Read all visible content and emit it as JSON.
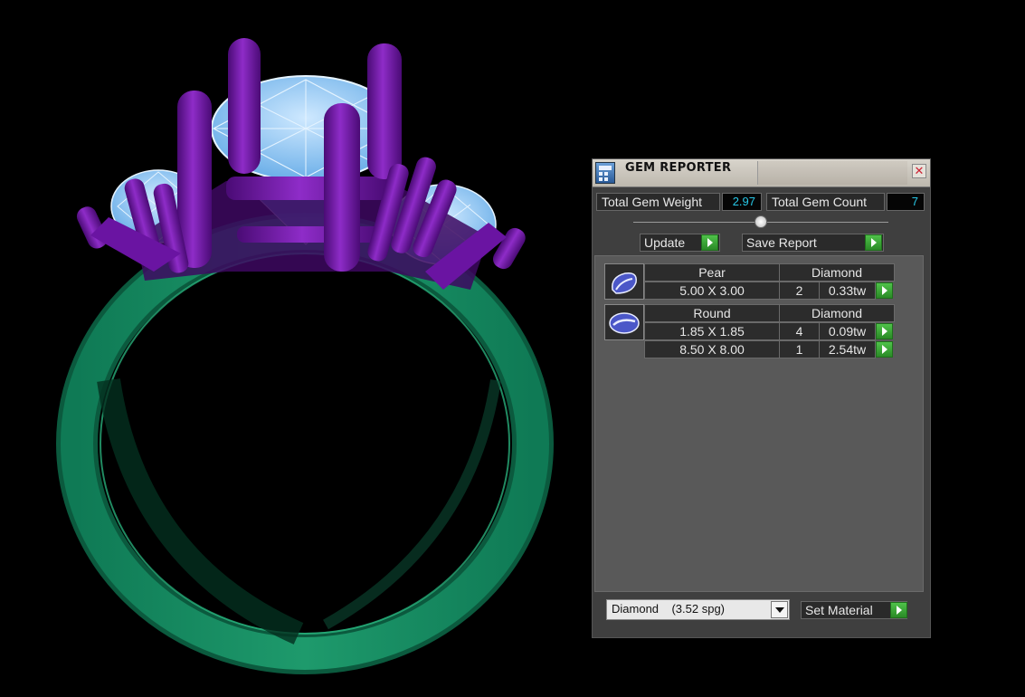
{
  "panel": {
    "title": "GEM REPORTER",
    "close_label": "✕",
    "total_gem_weight_label": "Total Gem Weight",
    "total_gem_weight_value": "2.97",
    "total_gem_count_label": "Total Gem Count",
    "total_gem_count_value": "7",
    "update_label": "Update",
    "save_report_label": "Save Report",
    "gems": [
      {
        "shape": "Pear",
        "material": "Diamond",
        "sizes": [
          {
            "dimensions": "5.00 X 3.00",
            "count": "2",
            "weight": "0.33tw"
          }
        ]
      },
      {
        "shape": "Round",
        "material": "Diamond",
        "sizes": [
          {
            "dimensions": "1.85 X 1.85",
            "count": "4",
            "weight": "0.09tw"
          },
          {
            "dimensions": "8.50 X 8.00",
            "count": "1",
            "weight": "2.54tw"
          }
        ]
      }
    ],
    "material_select": "Diamond    (3.52 spg)",
    "set_material_label": "Set Material"
  },
  "colors": {
    "metal": "#7a1ab0",
    "shank": "#0f7a55",
    "gem": "#9fd2ff",
    "value_text": "#27c7e6",
    "go_button": "#3aa834"
  },
  "icons": [
    "gem-reporter-icon",
    "close-icon",
    "pear-gem-icon",
    "round-gem-icon",
    "dropdown-arrow-icon",
    "go-arrow-icon",
    "slider-knob-icon"
  ]
}
